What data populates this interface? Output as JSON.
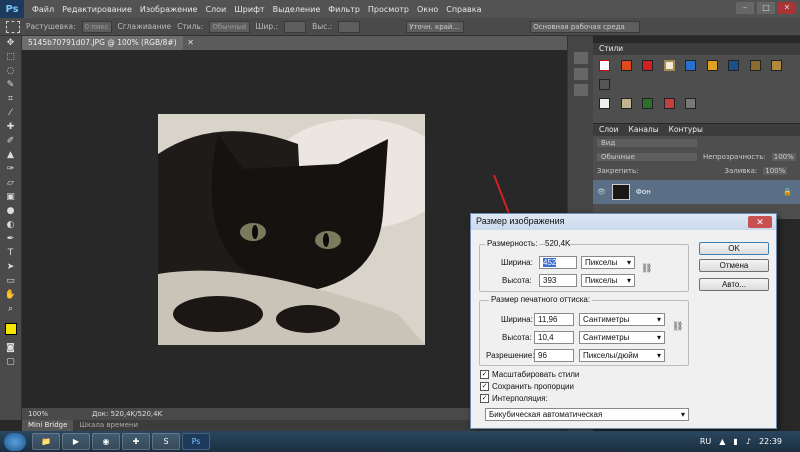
{
  "app": {
    "logo": "Ps"
  },
  "menu": [
    "Файл",
    "Редактирование",
    "Изображение",
    "Слои",
    "Шрифт",
    "Выделение",
    "Фильтр",
    "Просмотр",
    "Окно",
    "Справка"
  ],
  "options": {
    "feather_label": "Растушевка:",
    "feather_value": "0 пикс",
    "antialias_label": "Сглаживание",
    "style_label": "Стиль:",
    "style_value": "Обычный",
    "width_label": "Шир.:",
    "height_label": "Выс.:",
    "refine_button": "Уточн. край...",
    "workspace": "Основная рабочая среда"
  },
  "document": {
    "tab_title": "5145b70791d07.JPG @ 100% (RGB/8#)",
    "zoom": "100%",
    "doc_info": "Док: 520,4K/520,4K"
  },
  "bottom_tabs": [
    "Mini Bridge",
    "Шкала времени"
  ],
  "styles_panel": {
    "title": "Стили"
  },
  "layers_panel": {
    "tabs": [
      "Слои",
      "Каналы",
      "Контуры"
    ],
    "kind": "Вид",
    "blend_mode": "Обычные",
    "opacity_label": "Непрозрачность:",
    "opacity_value": "100%",
    "lock_label": "Закрепить:",
    "fill_label": "Заливка:",
    "fill_value": "100%",
    "layer_name": "Фон"
  },
  "dialog": {
    "title": "Размер изображения",
    "pixel_dims_label": "Размерность:",
    "pixel_dims_value": "520,4K",
    "width_label": "Ширина:",
    "width_value": "452",
    "width_unit": "Пикселы",
    "height_label": "Высота:",
    "height_value": "393",
    "height_unit": "Пикселы",
    "print_group": "Размер печатного оттиска:",
    "print_width_label": "Ширина:",
    "print_width_value": "11,96",
    "print_width_unit": "Сантиметры",
    "print_height_label": "Высота:",
    "print_height_value": "10,4",
    "print_height_unit": "Сантиметры",
    "resolution_label": "Разрешение:",
    "resolution_value": "96",
    "resolution_unit": "Пикселы/дюйм",
    "scale_styles": "Масштабировать стили",
    "constrain": "Сохранить пропорции",
    "resample": "Интерполяция:",
    "resample_method": "Бикубическая автоматическая",
    "ok": "OK",
    "cancel": "Отмена",
    "auto": "Авто..."
  },
  "taskbar": {
    "lang": "RU",
    "time": "22:39"
  },
  "colors": {
    "swatch_fg": "#f5e600",
    "annotation_arrow": "#d42020"
  }
}
